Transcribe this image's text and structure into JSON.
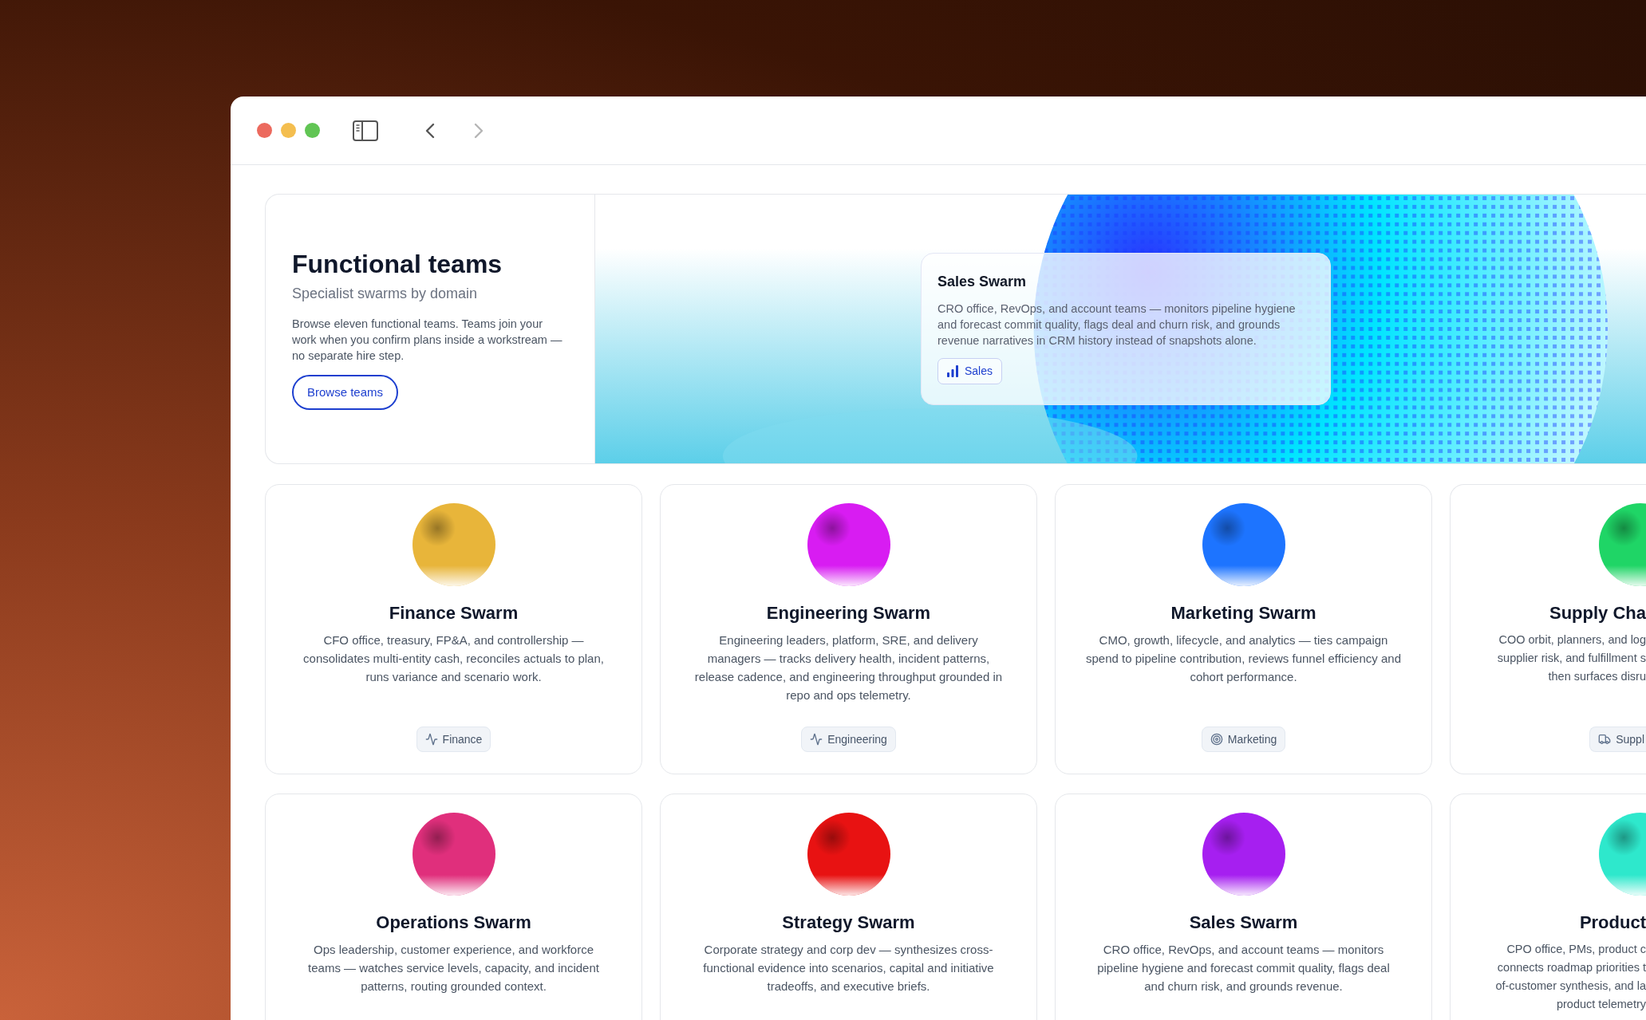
{
  "window": {
    "nav": {
      "back": {
        "disabled": false
      },
      "forward": {
        "disabled": true
      }
    }
  },
  "hero": {
    "title": "Functional teams",
    "subtitle": "Specialist swarms by domain",
    "description": "Browse eleven functional teams. Teams join your work when you confirm plans inside a workstream — no separate hire step.",
    "button": "Browse teams",
    "featured": {
      "title": "Sales Swarm",
      "description": "CRO office, RevOps, and account teams — monitors pipeline hygiene and forecast commit quality, flags deal and churn risk, and grounds revenue narratives in CRM history instead of snapshots alone.",
      "tag": "Sales"
    }
  },
  "teams": [
    {
      "kind": "full",
      "name": "Finance Swarm",
      "description": "CFO office, treasury, FP&A, and controllership — consolidates multi-entity cash, reconciles actuals to plan, runs variance and scenario work.",
      "tag": "Finance",
      "color": "#e8b53a"
    },
    {
      "kind": "full",
      "name": "Engineering Swarm",
      "description": "Engineering leaders, platform, SRE, and delivery managers — tracks delivery health, incident patterns, release cadence, and engineering throughput grounded in repo and ops telemetry.",
      "tag": "Engineering",
      "color": "#d81cf2"
    },
    {
      "kind": "full",
      "name": "Marketing Swarm",
      "description": "CMO, growth, lifecycle, and analytics — ties campaign spend to pipeline contribution, reviews funnel efficiency and cohort performance.",
      "tag": "Marketing",
      "color": "#1d74ff"
    },
    {
      "kind": "cut",
      "name": "Supply Cha",
      "lines": [
        "COO orbit, planners, and log",
        "supplier risk, and fulfillment s",
        "then surfaces disru"
      ],
      "tag": "Suppl",
      "color": "#1fd566"
    },
    {
      "kind": "full",
      "name": "Operations Swarm",
      "description": "Ops leadership, customer experience, and workforce teams — watches service levels, capacity, and incident patterns, routing grounded context.",
      "color": "#e02f7c"
    },
    {
      "kind": "full",
      "name": "Strategy Swarm",
      "description": "Corporate strategy and corp dev — synthesizes cross-functional evidence into scenarios, capital and initiative tradeoffs, and executive briefs.",
      "color": "#e81212"
    },
    {
      "kind": "full",
      "name": "Sales Swarm",
      "description": "CRO office, RevOps, and account teams — monitors pipeline hygiene and forecast commit quality, flags deal and churn risk, and grounds revenue.",
      "color": "#a61ff0"
    },
    {
      "kind": "cut",
      "name": "Product",
      "lines": [
        "CPO office, PMs, product c",
        "connects roadmap priorities t",
        "of-customer synthesis, and la",
        "product telemetry"
      ],
      "color": "#2ee8cc"
    }
  ]
}
